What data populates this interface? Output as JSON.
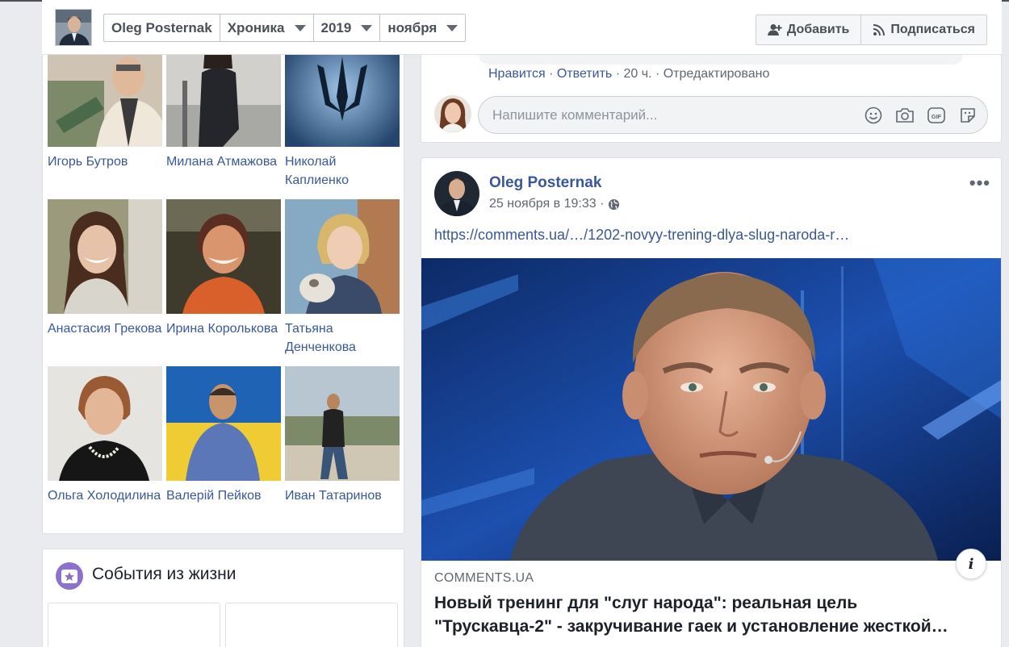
{
  "header": {
    "profile_name": "Oleg Posternak",
    "crumbs": [
      {
        "label": "Хроника"
      },
      {
        "label": "2019"
      },
      {
        "label": "ноября"
      }
    ],
    "add_label": "Добавить",
    "subscribe_label": "Подписаться"
  },
  "friends": [
    {
      "name": "Игорь Бутров",
      "colors": [
        "#b89a7a",
        "#e8e0d6"
      ]
    },
    {
      "name": "Милана Атмажова",
      "colors": [
        "#c9c7c4",
        "#2a2a2e"
      ]
    },
    {
      "name": "Николай Каплиенко",
      "colors": [
        "#5a7fa8",
        "#1d3550"
      ]
    },
    {
      "name": "Анастасия Грекова",
      "colors": [
        "#8a8a6a",
        "#d8c6b0"
      ]
    },
    {
      "name": "Ирина Королькова",
      "colors": [
        "#3d3a2e",
        "#d96a2a"
      ]
    },
    {
      "name": "Татьяна Денченкова",
      "colors": [
        "#7fa7c4",
        "#c8a879"
      ]
    },
    {
      "name": "Ольга Холодилина",
      "colors": [
        "#e4e2df",
        "#1e1e1e"
      ]
    },
    {
      "name": "Валерій Пейков",
      "colors": [
        "#1e66b8",
        "#f2d13a"
      ]
    },
    {
      "name": "Иван Татаринов",
      "colors": [
        "#9db2c6",
        "#6e7a5a"
      ]
    }
  ],
  "events": {
    "title": "События из жизни"
  },
  "comment": {
    "like_label": "Нравится",
    "reply_label": "Ответить",
    "time": "20 ч.",
    "edited_label": "Отредактировано",
    "input_placeholder": "Напишите комментарий..."
  },
  "post": {
    "author": "Oleg Posternak",
    "timestamp": "25 ноября в 19:33",
    "privacy_icon": "globe-icon",
    "link": "https://comments.ua/…/1202-novyy-trening-dlya-slug-naroda-r…",
    "domain": "COMMENTS.UA",
    "title_line1": "Новый тренинг для \"слуг народа\": реальная цель",
    "title_line2": "\"Трускавца-2\" - закручивание гаек и установление жесткой…",
    "info_glyph": "i"
  },
  "colors": {
    "link": "#385898",
    "secondary_text": "#606770",
    "page_bg": "#e9ebee",
    "events_icon": "#8c72cb"
  }
}
